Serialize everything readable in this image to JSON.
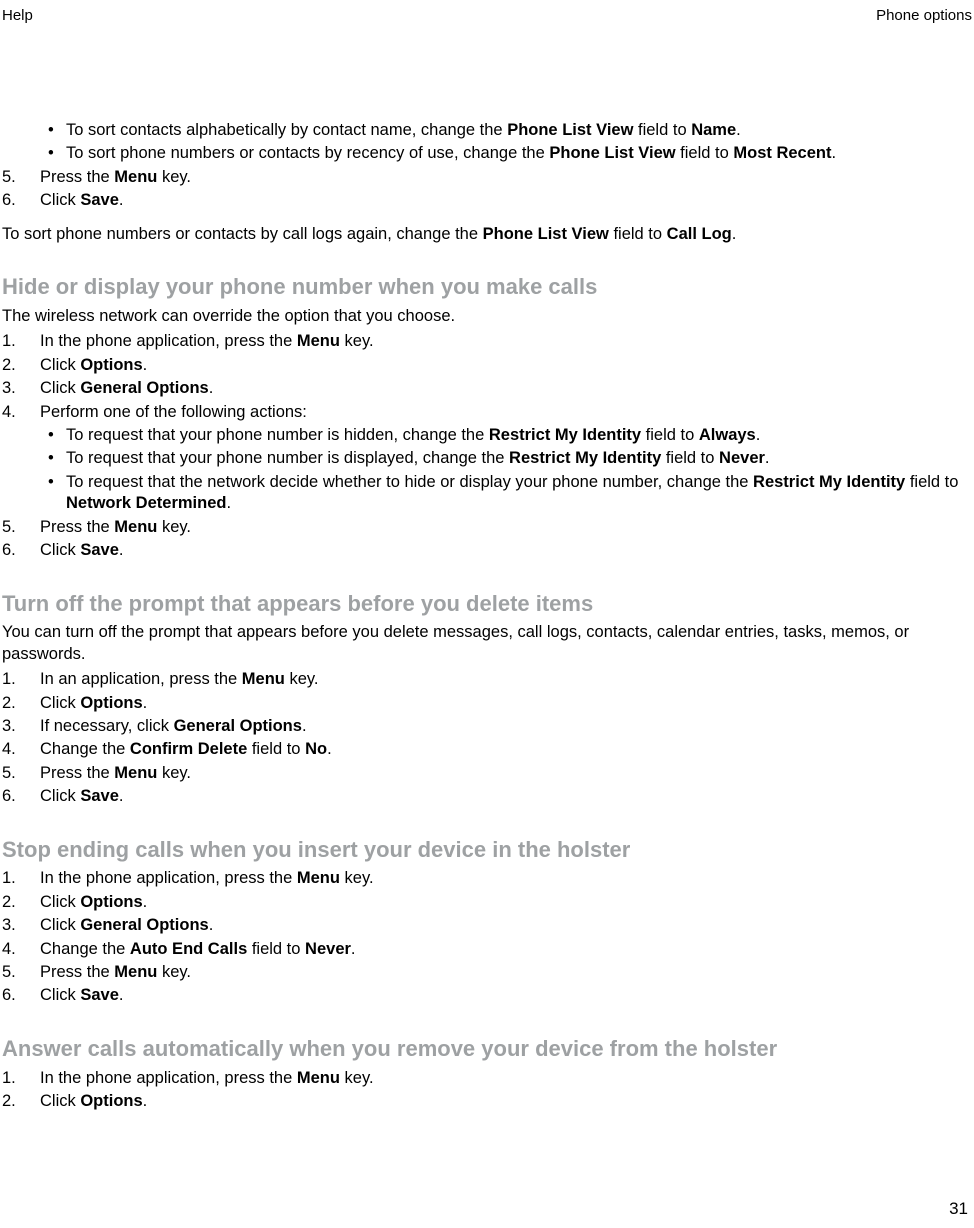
{
  "header": {
    "left": "Help",
    "right": "Phone options"
  },
  "page_number": "31",
  "intro": {
    "bullets": [
      {
        "pre": "To sort contacts alphabetically by contact name, change the ",
        "b1": "Phone List View",
        "mid": " field to ",
        "b2": "Name",
        "post": "."
      },
      {
        "pre": "To sort phone numbers or contacts by recency of use, change the ",
        "b1": "Phone List View",
        "mid": " field to ",
        "b2": "Most Recent",
        "post": "."
      }
    ],
    "steps": [
      {
        "n": "5.",
        "pre": "Press the ",
        "b1": "Menu",
        "post": " key."
      },
      {
        "n": "6.",
        "pre": "Click ",
        "b1": "Save",
        "post": "."
      }
    ],
    "after": {
      "pre": "To sort phone numbers or contacts by call logs again, change the ",
      "b1": "Phone List View",
      "mid": " field to ",
      "b2": "Call Log",
      "post": "."
    }
  },
  "s1": {
    "title": "Hide or display your phone number when you make calls",
    "intro": "The wireless network can override the option that you choose.",
    "steps_a": [
      {
        "n": "1.",
        "pre": "In the phone application, press the ",
        "b1": "Menu",
        "post": " key."
      },
      {
        "n": "2.",
        "pre": "Click ",
        "b1": "Options",
        "post": "."
      },
      {
        "n": "3.",
        "pre": "Click ",
        "b1": "General Options",
        "post": "."
      },
      {
        "n": "4.",
        "pre": "Perform one of the following actions:",
        "b1": "",
        "post": ""
      }
    ],
    "bullets": [
      {
        "pre": "To request that your phone number is hidden, change the ",
        "b1": "Restrict My Identity",
        "mid": " field to ",
        "b2": "Always",
        "post": "."
      },
      {
        "pre": "To request that your phone number is displayed, change the ",
        "b1": "Restrict My Identity",
        "mid": " field to ",
        "b2": "Never",
        "post": "."
      },
      {
        "pre": "To request that the network decide whether to hide or display your phone number, change the ",
        "b1": "Restrict My Identity",
        "mid": " field to ",
        "b2": "Network Determined",
        "post": "."
      }
    ],
    "steps_b": [
      {
        "n": "5.",
        "pre": "Press the ",
        "b1": "Menu",
        "post": " key."
      },
      {
        "n": "6.",
        "pre": "Click ",
        "b1": "Save",
        "post": "."
      }
    ]
  },
  "s2": {
    "title": "Turn off the prompt that appears before you delete items",
    "intro": "You can turn off the prompt that appears before you delete messages, call logs, contacts, calendar entries, tasks, memos, or passwords.",
    "steps": [
      {
        "n": "1.",
        "pre": "In an application, press the ",
        "b1": "Menu",
        "post": " key."
      },
      {
        "n": "2.",
        "pre": "Click ",
        "b1": "Options",
        "post": "."
      },
      {
        "n": "3.",
        "pre": "If necessary, click ",
        "b1": "General Options",
        "post": "."
      },
      {
        "n": "4.",
        "pre": "Change the ",
        "b1": "Confirm Delete",
        "mid": " field to ",
        "b2": "No",
        "post": "."
      },
      {
        "n": "5.",
        "pre": "Press the ",
        "b1": "Menu",
        "post": " key."
      },
      {
        "n": "6.",
        "pre": "Click ",
        "b1": "Save",
        "post": "."
      }
    ]
  },
  "s3": {
    "title": "Stop ending calls when you insert your device in the holster",
    "steps": [
      {
        "n": "1.",
        "pre": "In the phone application, press the ",
        "b1": "Menu",
        "post": " key."
      },
      {
        "n": "2.",
        "pre": "Click ",
        "b1": "Options",
        "post": "."
      },
      {
        "n": "3.",
        "pre": "Click ",
        "b1": "General Options",
        "post": "."
      },
      {
        "n": "4.",
        "pre": "Change the ",
        "b1": "Auto End Calls",
        "mid": " field to ",
        "b2": "Never",
        "post": "."
      },
      {
        "n": "5.",
        "pre": "Press the ",
        "b1": "Menu",
        "post": " key."
      },
      {
        "n": "6.",
        "pre": "Click ",
        "b1": "Save",
        "post": "."
      }
    ]
  },
  "s4": {
    "title": "Answer calls automatically when you remove your device from the holster",
    "steps": [
      {
        "n": "1.",
        "pre": "In the phone application, press the ",
        "b1": "Menu",
        "post": " key."
      },
      {
        "n": "2.",
        "pre": "Click ",
        "b1": "Options",
        "post": "."
      }
    ]
  }
}
